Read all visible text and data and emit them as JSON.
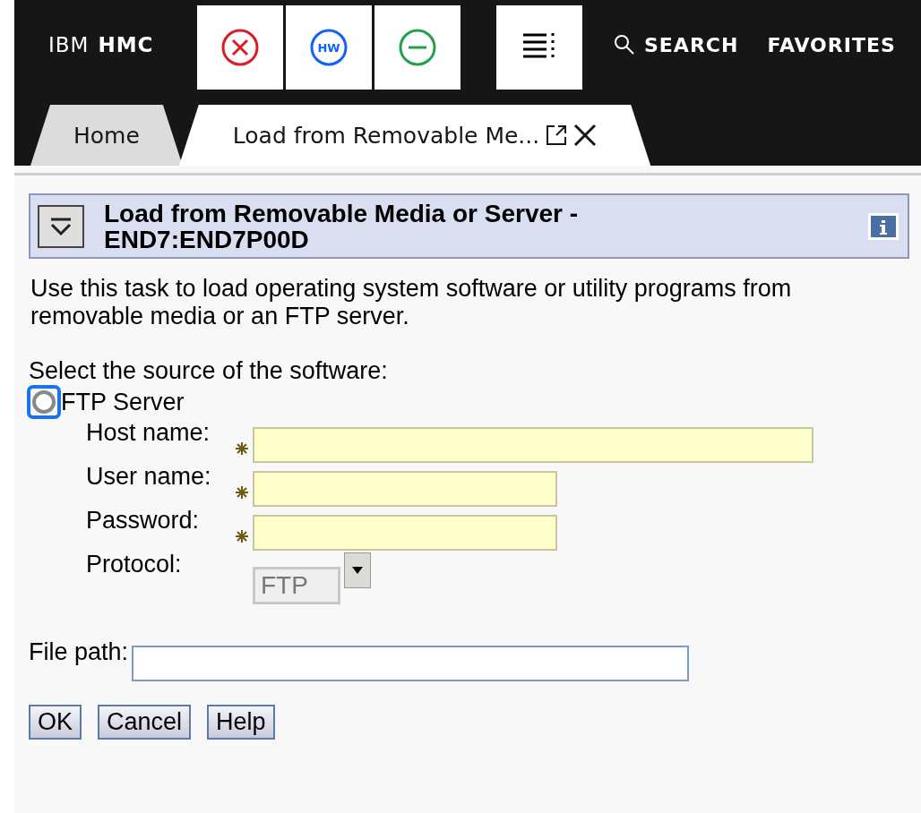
{
  "header": {
    "brand_light": "IBM",
    "brand_bold": "HMC",
    "toolbar": [
      {
        "kind": "error"
      },
      {
        "kind": "hw"
      },
      {
        "kind": "minus"
      }
    ],
    "hw_label": "HW",
    "menu": {
      "kind": "menu"
    },
    "search": "SEARCH",
    "favorites": "FAVORITES"
  },
  "tabs": [
    {
      "label": "Home",
      "selected": false
    },
    {
      "label": "Load from Removable Me...",
      "selected": true
    }
  ],
  "panel": {
    "title": "Load from Removable Media or Server - END7:END7P00D",
    "expanded": true
  },
  "description": "Use this task to load operating system software or utility programs from removable media or an FTP server.",
  "source_label": "Select the source of the software:",
  "sources": [
    {
      "label": "FTP Server",
      "selected": false,
      "focused": true
    }
  ],
  "fields": [
    {
      "label": "Host name:",
      "required": true
    },
    {
      "label": "User name:",
      "required": true
    },
    {
      "label": "Password:",
      "required": true
    }
  ],
  "protocol": {
    "label": "Protocol:",
    "value": "FTP",
    "disabled": true
  },
  "file_path": {
    "label": "File path:"
  },
  "buttons": [
    "OK",
    "Cancel",
    "Help"
  ]
}
